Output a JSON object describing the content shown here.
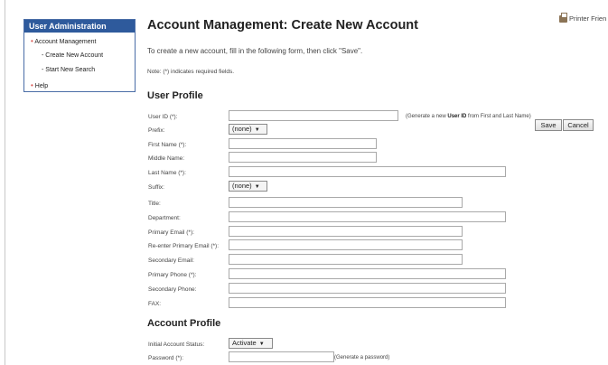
{
  "sidebar": {
    "title": "User Administration",
    "items": [
      {
        "label": "Account Management",
        "bullet": "•"
      },
      {
        "label": "- Create New Account"
      },
      {
        "label": "- Start New Search"
      },
      {
        "label": "Help",
        "bullet": "•"
      }
    ]
  },
  "printer_label": "Printer Frien",
  "page_title": "Account Management: Create New Account",
  "intro": "To create a new account, fill in the following form, then click \"Save\".",
  "note": "Note: (*) indicates required fields.",
  "buttons": {
    "save": "Save",
    "cancel": "Cancel"
  },
  "user_profile": {
    "heading": "User Profile",
    "user_id_label": "User ID (*):",
    "generate_user_id_pre": "(Generate a new ",
    "generate_user_id_bold": "User ID",
    "generate_user_id_post": " from First and Last Name)",
    "prefix_label": "Prefix:",
    "prefix_value": "(none)",
    "first_name_label": "First Name (*):",
    "middle_name_label": "Middle Name:",
    "last_name_label": "Last Name (*):",
    "suffix_label": "Suffix:",
    "suffix_value": "(none)",
    "title_label": "Title:",
    "department_label": "Department:",
    "primary_email_label": "Primary Email (*):",
    "reenter_email_label": "Re-enter Primary Email (*):",
    "secondary_email_label": "Secondary Email:",
    "primary_phone_label": "Primary Phone (*):",
    "secondary_phone_label": "Secondary Phone:",
    "fax_label": "FAX:"
  },
  "account_profile": {
    "heading": "Account Profile",
    "status_label": "Initial Account Status:",
    "status_value": "Activate",
    "password_label": "Password (*):",
    "generate_password": "(Generate a password)"
  },
  "colors": {
    "sidebar_header": "#2e5a9c",
    "bullet": "#d9534f",
    "border": "#4a6da7"
  }
}
